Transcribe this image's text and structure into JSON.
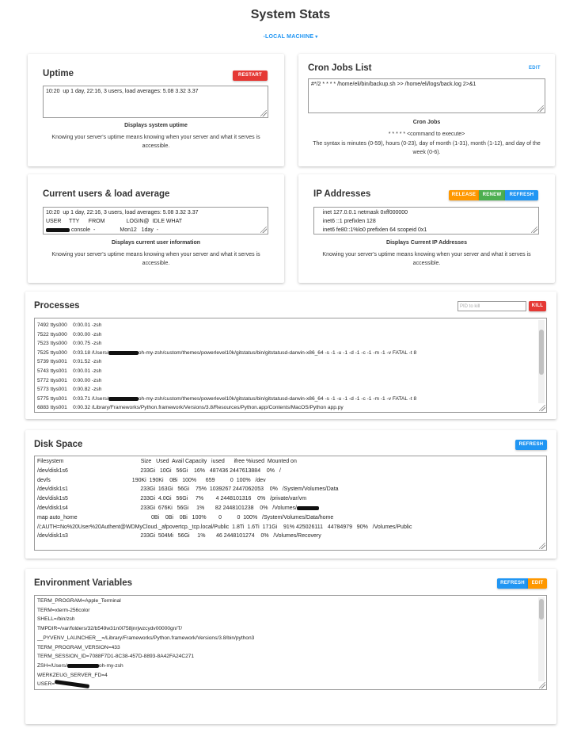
{
  "page": {
    "title": "System Stats",
    "machine": "-LOCAL MACHINE"
  },
  "uptime": {
    "title": "Uptime",
    "restart_label": "RESTART",
    "text": "10:20  up 1 day, 22:16, 3 users, load averages: 5.08 3.32 3.37",
    "caption": "Displays system uptime",
    "description": "Knowing your server's uptime means knowing when your server and what it serves is accessible."
  },
  "cron": {
    "title": "Cron Jobs List",
    "edit_label": "EDIT",
    "text": "#*/2 * * * * /home/eli/bin/backup.sh >> /home/eli/logs/back.log 2>&1",
    "caption": "Cron Jobs",
    "syntax_line": "* * * * * <command to execute>",
    "description": "The syntax is minutes (0-59), hours (0-23), day of month (1-31), month (1-12), and day of the week (0-6)."
  },
  "users": {
    "title": "Current users & load average",
    "lines": [
      "10:20  up 1 day, 22:16, 3 users, load averages: 5.08 3.32 3.37",
      "USER     TTY      FROM              LOGIN@  IDLE WHAT",
      " console  -                Mon12   1day  -"
    ],
    "caption": "Displays current user information",
    "description": "Knowing your server's uptime means knowing when your server and what it serves is accessible."
  },
  "ip": {
    "title": "IP Addresses",
    "release_label": "RELEASE",
    "renew_label": "RENEW",
    "refresh_label": "REFRESH",
    "lines": [
      "    inet 127.0.0.1 netmask 0xff000000",
      "    inet6 ::1 prefixlen 128",
      "    inet6 fe80::1%lo0 prefixlen 64 scopeid 0x1"
    ],
    "caption": "Displays Current IP Addresses",
    "description": "Knowing your server's uptime means knowing when your server and what it serves is accessible."
  },
  "processes": {
    "title": "Processes",
    "pid_placeholder": "PID to kill",
    "kill_label": "KILL",
    "lines": [
      "7492 ttys000    0:00.01 -zsh",
      "7522 ttys000    0:00.00 -zsh",
      "7523 ttys000    0:00.75 -zsh",
      "7525 ttys000    0:03.18 /Users/",
      "5739 ttys001    0:01.52 -zsh",
      "5743 ttys001    0:00.01 -zsh",
      "5772 ttys001    0:00.00 -zsh",
      "5773 ttys001    0:00.82 -zsh",
      "5775 ttys001    0:03.71 /Users/",
      "6883 ttys001    0:00.32 /Library/Frameworks/Python.framework/Versions/3.8/Resources/Python.app/Contents/MacOS/Python app.py"
    ],
    "gitstatus_tail": "oh-my-zsh/custom/themes/powerlevel10k/gitstatus/bin/gitstatusd-darwin-x86_64 -s -1 -u -1 -d -1 -c -1 -m -1 -v FATAL -t 8"
  },
  "disk": {
    "title": "Disk Space",
    "refresh_label": "REFRESH",
    "lines": [
      "Filesystem                                                  Size   Used  Avail Capacity   iused      ifree %iused  Mounted on",
      "/dev/disk1s6                                               233Gi   10Gi   56Gi    16%   487436 2447613884    0%   /",
      "devfs                                                     190Ki  190Ki    0Bi   100%      659          0  100%   /dev",
      "/dev/disk1s1                                               233Gi  163Gi   56Gi    75%  1039267 2447062053    0%   /System/Volumes/Data",
      "/dev/disk1s5                                               233Gi  4.0Gi   56Gi     7%        4 2448101316    0%   /private/var/vm",
      "/dev/disk1s4                                               233Gi  676Ki   56Gi     1%       82 2448101238    0%   /Volumes/",
      "map auto_home                                                0Bi    0Bi    0Bi   100%        0          0  100%   /System/Volumes/Data/home",
      "//;AUTH=No%20User%20Authent@WDMyCloud._afpovertcp._tcp.local/Public  1.8Ti  1.6Ti  171Gi    91% 425026111   44784979   90%   /Volumes/Public",
      "/dev/disk1s3                                               233Gi  504Mi   56Gi     1%       46 2448101274    0%   /Volumes/Recovery"
    ]
  },
  "env": {
    "title": "Environment Variables",
    "refresh_label": "REFRESH",
    "edit_label": "EDIT",
    "lines": [
      "TERM_PROGRAM=Apple_Terminal",
      "TERM=xterm-256color",
      "SHELL=/bin/zsh",
      "TMPDIR=/var/folders/32/b549w31n0l758jnrjwzcydv00000gn/T/",
      "__PYVENV_LAUNCHER__=/Library/Frameworks/Python.framework/Versions/3.8/bin/python3",
      "TERM_PROGRAM_VERSION=433",
      "TERM_SESSION_ID=7088F7D1-8C38-457D-8893-8A42FA24C271",
      "ZSH=/Users/",
      "WERKZEUG_SERVER_FD=4",
      "USER="
    ],
    "zsh_tail": "oh-my-zsh"
  }
}
